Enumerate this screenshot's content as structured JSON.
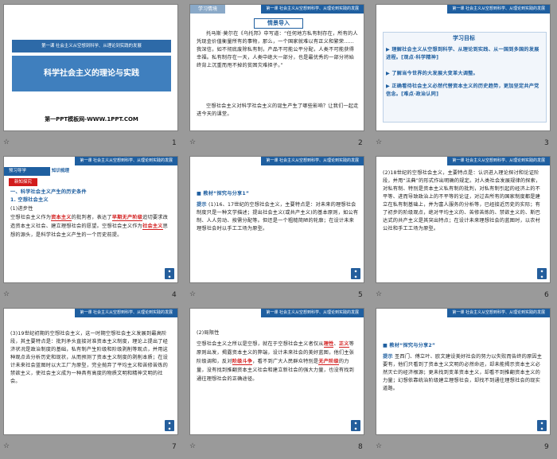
{
  "slides": [
    {
      "number": "1",
      "banner": "第一课  社会主义从空想到科学、从理论到实践的发展",
      "title": "科学社会主义的理论与实践",
      "footer": "第一PPT模板网-WWW.1PPT.COM"
    },
    {
      "number": "2",
      "tag": "学习情境",
      "header": "第一课  社会主义从空想到科学、从理论到实践的发展",
      "heading": "情景导入",
      "para1": "托马斯·莫尔在《乌托邦》中写道：“任何地方私有制存在，所有的人凭现金价值衡量所有的事物，那么，一个国家就难以有正义和繁荣……我深信，如不彻底废除私有制，产品不可能公平分配，人类不可能获得幸福。私有制存在一天，人类中绝大一部分，也是最优秀的一部分将始终背上沉重而甩不掉的贫困灾难担子。”",
      "para2": "空想社会主义对科学社会主义的诞生产生了哪些影响？让我们一起走进今天的课堂。"
    },
    {
      "number": "3",
      "header": "第一课  社会主义从空想到科学、从理论到实践的发展",
      "heading": "学习目标",
      "items": [
        "理解社会主义从空想到科学、从理论到实践、从一国到多国的发展进程。[观点·科学精神]",
        "了解当今世界的大发展大变革大调整。",
        "正确看待社会主义必然代替资本主义的历史趋势，更加坚定共产党信念。[难点·政治认同]"
      ]
    },
    {
      "number": "4",
      "tag": "预习导学",
      "tag2": "知识梳理",
      "header": "第一课  社会主义从空想到科学、从理论到实践的发展",
      "subtag": "新知探究",
      "h1": "一、科学社会主义产生的历史条件",
      "h2": "1. 空想社会主义",
      "h3": "(1)进步性",
      "fill1": "资本主义",
      "fill2": "早期无产阶级",
      "fill3": "社会主义",
      "t1": "空想社会主义作为",
      "t2": "的批判者，表达了",
      "t3": "追切要求改造资本主义社会、建立理想社会的愿望。空想社会主义作为",
      "t4": "思想的源头，是科学社会主义产生的一个历史前提。"
    },
    {
      "number": "5",
      "header": "第一课  社会主义从空想到科学、从理论到实践的发展",
      "subhead": "教材“探究与分享1”",
      "prompt": "提示",
      "text": "(1)16、17世纪的空想社会主义，主要特点是：对未来的理想社会制度只是一种文学描述；提出社会主义(或共产主义)的基本原则，如公有制、人人劳动、按需分配等。但还是一个粗糙简陋的轮廓；在设计未来理想社会时以手工工场为原型。"
    },
    {
      "number": "6",
      "header": "第一课  社会主义从空想到科学、从理论到实践的发展",
      "text": "(2)18世纪的空想社会主义，主要特点是：认识进入理论探讨和论证阶段，并用“法典”的形式作出明确的规定。对人类社会发展规律的探索，对私有制、特别是资本主义私有制的批判，对私有制引起的经济上的不平等、进而导致政治上的不平等的论证，对过去所有的国家制度都是建立在私有制基础上，并为富人服务的分析等，已经接近历史的实际；有了初步的阶级观点，绝对平均主义的、苦修苦炼的、禁欲主义的、斯巴达式的共产主义是其突出特点；在设计未来理想社会的蓝图时，以农村公社和手工工场为原型。"
    },
    {
      "number": "7",
      "header": "第一课  社会主义从空想到科学、从理论到实践的发展",
      "text": "(3)19世纪初期的空想社会主义，这一时期空想社会主义发展到最高阶段，其主要特点是：批判矛头直接对准资本主义制度，理论上提出了经济状况是政治制度的基础，私有制产生阶级和阶级剥削等观点，并用这种观点去分析历史和现状，从而预测了资本主义制度的剥削本质；在设计未来社会蓝图时以大工厂为原型，完全抛弃了平均主义和苦修苦炼的禁欲主义，使社会主义成为一种具有高度的物质文明和精神文明的社会。"
    },
    {
      "number": "8",
      "header": "第一课  社会主义从空想到科学、从理论到实践的发展",
      "h3": "(2)局限性",
      "t1": "空想社会主义之所以是空想，就在于空想社会主义者仅从",
      "fill1": "理性",
      "fill2": "正义",
      "t2": "等原则出发，揭露资本主义的弊端，设计未来社会的美好蓝图，他们主张阶级调和，反对",
      "fill3": "阶级斗争",
      "t3": "，看不到广大人民群众特别是",
      "fill4": "无产阶级",
      "t4": "的力量，没有找到推翻资本主义社会和建立新社会的强大力量，也没有找到通往理想社会的正确途径。"
    },
    {
      "number": "9",
      "header": "第一课  社会主义从空想到科学、从理论到实践的发展",
      "subhead": "教材“探究与分享2”",
      "prompt": "提示",
      "text": "圣西门、傅立叶、欧文建设美好社会的努力以失败而告终的原因主要有，他们只看到了资本主义文明的必然命运，却未能揭示资本主义必然灭亡的经济根源；更未找到变革资本主义，却看不到推翻资本主义的力量；幻想依靠统治阶级建立理想社会，却找不到通往理想社会的现实道路。"
    }
  ],
  "colors": {
    "accent": "#1f5fa0",
    "red": "#d21c1c",
    "background": "#9a9a9a"
  }
}
